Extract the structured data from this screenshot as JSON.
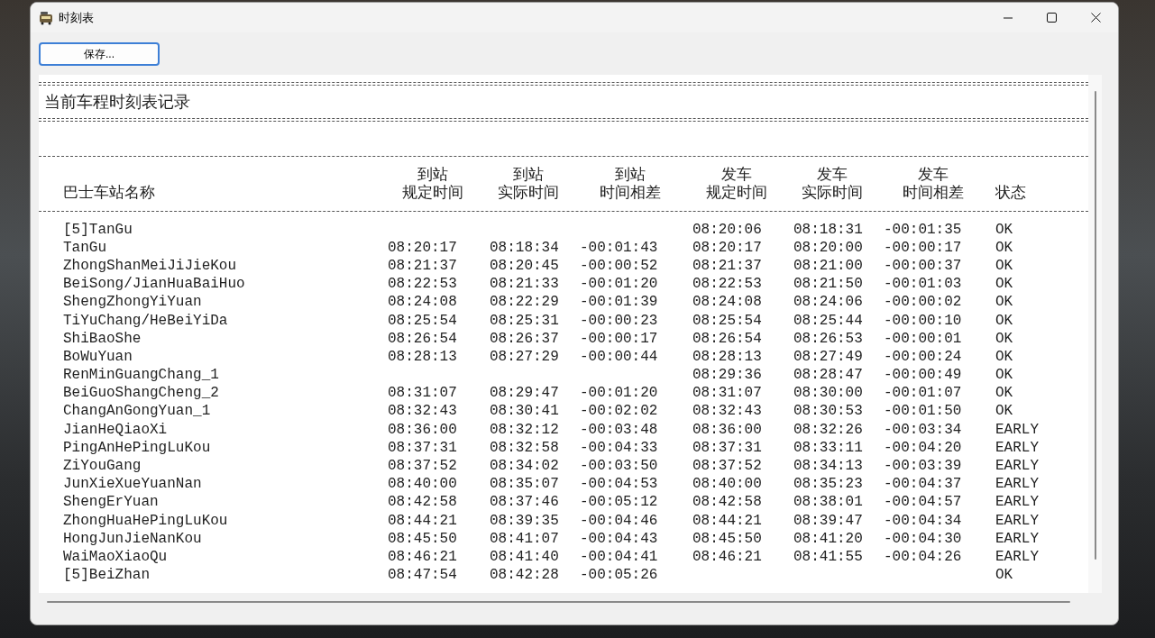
{
  "window": {
    "title": "时刻表"
  },
  "save_button": {
    "label": "保存..."
  },
  "report": {
    "title": "当前车程时刻表记录",
    "columns": [
      {
        "line2": "巴士车站名称"
      },
      {
        "line1": "到站",
        "line2": "规定时间"
      },
      {
        "line1": "到站",
        "line2": "实际时间"
      },
      {
        "line1": "到站",
        "line2": "时间相差"
      },
      {
        "line1": "发车",
        "line2": "规定时间"
      },
      {
        "line1": "发车",
        "line2": "实际时间"
      },
      {
        "line1": "发车",
        "line2": "时间相差"
      },
      {
        "line2": "状态"
      }
    ],
    "rows": [
      {
        "station": "[5]TanGu",
        "dep_scheduled": "08:20:06",
        "dep_actual": "08:18:31",
        "dep_diff": "-00:01:35",
        "status": "OK"
      },
      {
        "station": "TanGu",
        "arr_scheduled": "08:20:17",
        "arr_actual": "08:18:34",
        "arr_diff": "-00:01:43",
        "dep_scheduled": "08:20:17",
        "dep_actual": "08:20:00",
        "dep_diff": "-00:00:17",
        "status": "OK"
      },
      {
        "station": "ZhongShanMeiJiJieKou",
        "arr_scheduled": "08:21:37",
        "arr_actual": "08:20:45",
        "arr_diff": "-00:00:52",
        "dep_scheduled": "08:21:37",
        "dep_actual": "08:21:00",
        "dep_diff": "-00:00:37",
        "status": "OK"
      },
      {
        "station": "BeiSong/JianHuaBaiHuo",
        "arr_scheduled": "08:22:53",
        "arr_actual": "08:21:33",
        "arr_diff": "-00:01:20",
        "dep_scheduled": "08:22:53",
        "dep_actual": "08:21:50",
        "dep_diff": "-00:01:03",
        "status": "OK"
      },
      {
        "station": "ShengZhongYiYuan",
        "arr_scheduled": "08:24:08",
        "arr_actual": "08:22:29",
        "arr_diff": "-00:01:39",
        "dep_scheduled": "08:24:08",
        "dep_actual": "08:24:06",
        "dep_diff": "-00:00:02",
        "status": "OK"
      },
      {
        "station": "TiYuChang/HeBeiYiDa",
        "arr_scheduled": "08:25:54",
        "arr_actual": "08:25:31",
        "arr_diff": "-00:00:23",
        "dep_scheduled": "08:25:54",
        "dep_actual": "08:25:44",
        "dep_diff": "-00:00:10",
        "status": "OK"
      },
      {
        "station": "ShiBaoShe",
        "arr_scheduled": "08:26:54",
        "arr_actual": "08:26:37",
        "arr_diff": "-00:00:17",
        "dep_scheduled": "08:26:54",
        "dep_actual": "08:26:53",
        "dep_diff": "-00:00:01",
        "status": "OK"
      },
      {
        "station": "BoWuYuan",
        "arr_scheduled": "08:28:13",
        "arr_actual": "08:27:29",
        "arr_diff": "-00:00:44",
        "dep_scheduled": "08:28:13",
        "dep_actual": "08:27:49",
        "dep_diff": "-00:00:24",
        "status": "OK"
      },
      {
        "station": "RenMinGuangChang_1",
        "dep_scheduled": "08:29:36",
        "dep_actual": "08:28:47",
        "dep_diff": "-00:00:49",
        "status": "OK"
      },
      {
        "station": "BeiGuoShangCheng_2",
        "arr_scheduled": "08:31:07",
        "arr_actual": "08:29:47",
        "arr_diff": "-00:01:20",
        "dep_scheduled": "08:31:07",
        "dep_actual": "08:30:00",
        "dep_diff": "-00:01:07",
        "status": "OK"
      },
      {
        "station": "ChangAnGongYuan_1",
        "arr_scheduled": "08:32:43",
        "arr_actual": "08:30:41",
        "arr_diff": "-00:02:02",
        "dep_scheduled": "08:32:43",
        "dep_actual": "08:30:53",
        "dep_diff": "-00:01:50",
        "status": "OK"
      },
      {
        "station": "JianHeQiaoXi",
        "arr_scheduled": "08:36:00",
        "arr_actual": "08:32:12",
        "arr_diff": "-00:03:48",
        "dep_scheduled": "08:36:00",
        "dep_actual": "08:32:26",
        "dep_diff": "-00:03:34",
        "status": "EARLY"
      },
      {
        "station": "PingAnHePingLuKou",
        "arr_scheduled": "08:37:31",
        "arr_actual": "08:32:58",
        "arr_diff": "-00:04:33",
        "dep_scheduled": "08:37:31",
        "dep_actual": "08:33:11",
        "dep_diff": "-00:04:20",
        "status": "EARLY"
      },
      {
        "station": "ZiYouGang",
        "arr_scheduled": "08:37:52",
        "arr_actual": "08:34:02",
        "arr_diff": "-00:03:50",
        "dep_scheduled": "08:37:52",
        "dep_actual": "08:34:13",
        "dep_diff": "-00:03:39",
        "status": "EARLY"
      },
      {
        "station": "JunXieXueYuanNan",
        "arr_scheduled": "08:40:00",
        "arr_actual": "08:35:07",
        "arr_diff": "-00:04:53",
        "dep_scheduled": "08:40:00",
        "dep_actual": "08:35:23",
        "dep_diff": "-00:04:37",
        "status": "EARLY"
      },
      {
        "station": "ShengErYuan",
        "arr_scheduled": "08:42:58",
        "arr_actual": "08:37:46",
        "arr_diff": "-00:05:12",
        "dep_scheduled": "08:42:58",
        "dep_actual": "08:38:01",
        "dep_diff": "-00:04:57",
        "status": "EARLY"
      },
      {
        "station": "ZhongHuaHePingLuKou",
        "arr_scheduled": "08:44:21",
        "arr_actual": "08:39:35",
        "arr_diff": "-00:04:46",
        "dep_scheduled": "08:44:21",
        "dep_actual": "08:39:47",
        "dep_diff": "-00:04:34",
        "status": "EARLY"
      },
      {
        "station": "HongJunJieNanKou",
        "arr_scheduled": "08:45:50",
        "arr_actual": "08:41:07",
        "arr_diff": "-00:04:43",
        "dep_scheduled": "08:45:50",
        "dep_actual": "08:41:20",
        "dep_diff": "-00:04:30",
        "status": "EARLY"
      },
      {
        "station": "WaiMaoXiaoQu",
        "arr_scheduled": "08:46:21",
        "arr_actual": "08:41:40",
        "arr_diff": "-00:04:41",
        "dep_scheduled": "08:46:21",
        "dep_actual": "08:41:55",
        "dep_diff": "-00:04:26",
        "status": "EARLY"
      },
      {
        "station": "[5]BeiZhan",
        "arr_scheduled": "08:47:54",
        "arr_actual": "08:42:28",
        "arr_diff": "-00:05:26",
        "status": "OK"
      }
    ]
  }
}
